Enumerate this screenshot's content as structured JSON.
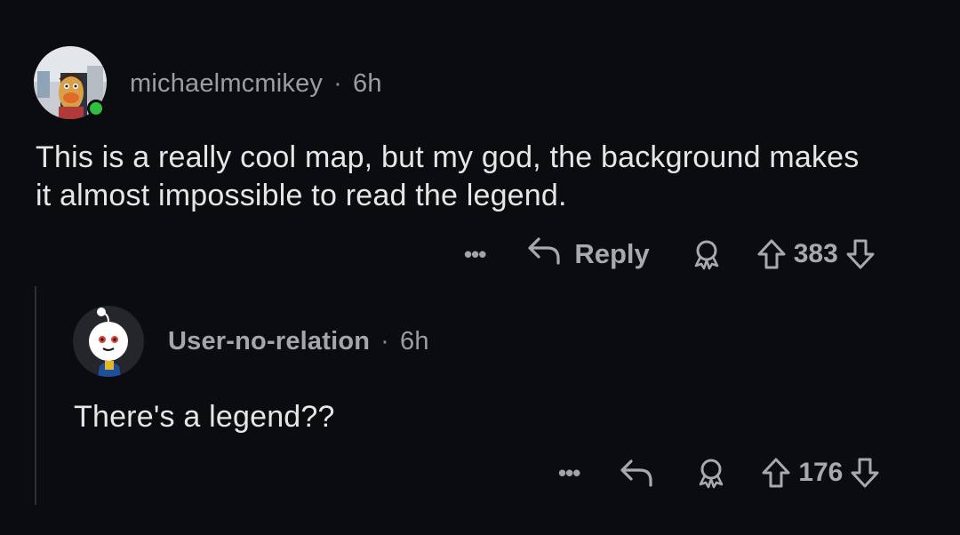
{
  "comments": [
    {
      "username": "michaelmcmikey",
      "separator": "·",
      "age": "6h",
      "body": "This is a really cool map, but my god, the background makes it almost impossible to read the legend.",
      "more": "•••",
      "reply_label": "Reply",
      "votes": "383"
    },
    {
      "username": "User-no-relation",
      "separator": "·",
      "age": "6h",
      "body": "There's a legend??",
      "more": "•••",
      "votes": "176"
    }
  ],
  "icons": {
    "reply": "reply-arrow-icon",
    "award": "award-icon",
    "upvote": "upvote-arrow-icon",
    "downvote": "downvote-arrow-icon",
    "online": "online-status-dot"
  },
  "colors": {
    "background": "#0b0c0f",
    "online": "#2fbf3f",
    "muted": "#9a9ea3"
  }
}
